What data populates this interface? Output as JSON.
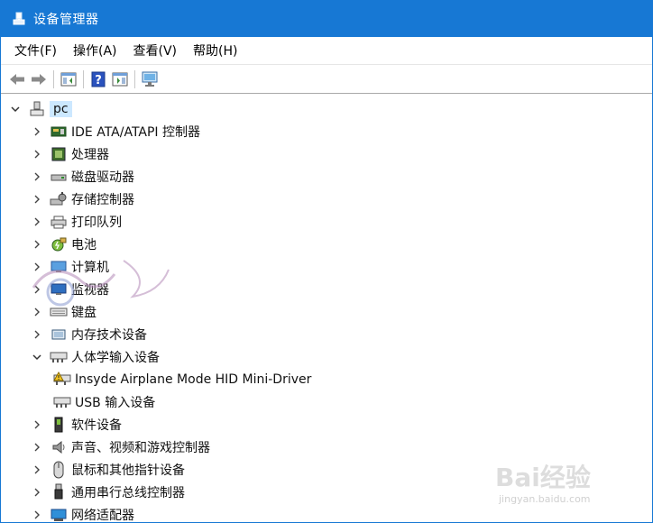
{
  "window": {
    "title": "设备管理器"
  },
  "menu": [
    {
      "label": "文件(F)"
    },
    {
      "label": "操作(A)"
    },
    {
      "label": "查看(V)"
    },
    {
      "label": "帮助(H)"
    }
  ],
  "toolbar": [
    {
      "icon": "back-arrow-icon"
    },
    {
      "icon": "forward-arrow-icon"
    },
    {
      "icon": "show-hide-console-tree-icon"
    },
    {
      "icon": "help-icon"
    },
    {
      "icon": "properties-icon"
    },
    {
      "icon": "scan-hardware-icon"
    }
  ],
  "tree": {
    "root": {
      "label": "pc",
      "expanded": true,
      "icon": "computer-icon"
    },
    "categories": [
      {
        "label": "IDE ATA/ATAPI 控制器",
        "icon": "ide-controller-icon",
        "expanded": false
      },
      {
        "label": "处理器",
        "icon": "processor-icon",
        "expanded": false
      },
      {
        "label": "磁盘驱动器",
        "icon": "disk-drive-icon",
        "expanded": false
      },
      {
        "label": "存储控制器",
        "icon": "storage-controller-icon",
        "expanded": false
      },
      {
        "label": "打印队列",
        "icon": "printer-icon",
        "expanded": false
      },
      {
        "label": "电池",
        "icon": "battery-icon",
        "expanded": false
      },
      {
        "label": "计算机",
        "icon": "monitor-computer-icon",
        "expanded": false
      },
      {
        "label": "监视器",
        "icon": "monitor-icon",
        "expanded": false
      },
      {
        "label": "键盘",
        "icon": "keyboard-icon",
        "expanded": false
      },
      {
        "label": "内存技术设备",
        "icon": "memory-device-icon",
        "expanded": false
      },
      {
        "label": "人体学输入设备",
        "icon": "hid-icon",
        "expanded": true,
        "children": [
          {
            "label": "Insyde Airplane Mode HID Mini-Driver",
            "icon": "hid-warning-icon"
          },
          {
            "label": "USB 输入设备",
            "icon": "hid-icon"
          }
        ]
      },
      {
        "label": "软件设备",
        "icon": "software-device-icon",
        "expanded": false
      },
      {
        "label": "声音、视频和游戏控制器",
        "icon": "speaker-icon",
        "expanded": false
      },
      {
        "label": "鼠标和其他指针设备",
        "icon": "mouse-icon",
        "expanded": false
      },
      {
        "label": "通用串行总线控制器",
        "icon": "usb-icon",
        "expanded": false
      },
      {
        "label": "网络适配器",
        "icon": "network-adapter-icon",
        "expanded": false
      }
    ]
  },
  "watermark": {
    "brand": "Bai经验",
    "url": "jingyan.baidu.com"
  },
  "colors": {
    "titlebar": "#1778d4",
    "selection": "#cce8ff"
  }
}
